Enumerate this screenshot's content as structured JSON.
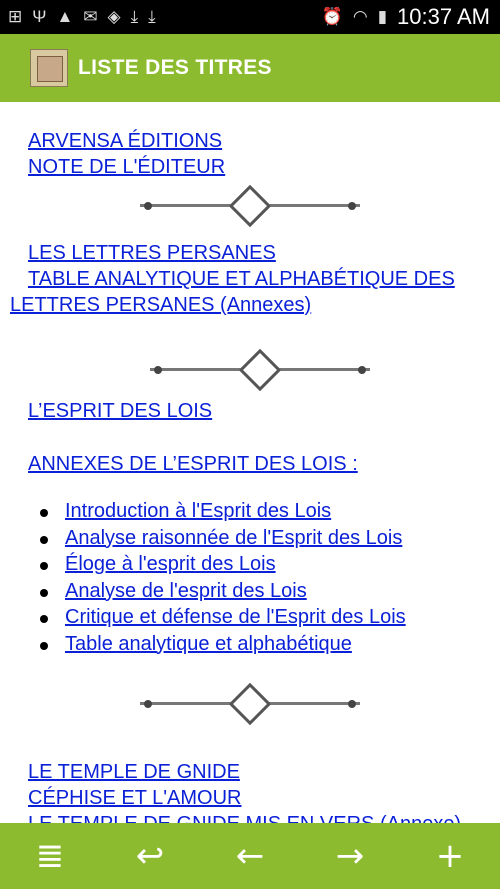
{
  "status_bar": {
    "time": "10:37 AM",
    "left_icons": [
      "plus-square-icon",
      "usb-icon",
      "warning-icon",
      "mail-blocked-icon",
      "shield-icon",
      "download-icon",
      "download-icon"
    ],
    "right_icons": [
      "alarm-icon",
      "wifi-icon",
      "battery-charging-icon"
    ]
  },
  "app_bar": {
    "title": "LISTE DES TITRES",
    "icon": "book-cover-icon",
    "color": "#8dbb2f"
  },
  "content": {
    "links_top": [
      "ARVENSA ÉDITIONS",
      "NOTE DE L'ÉDITEUR"
    ],
    "lettres": {
      "link1": "LES LETTRES PERSANES",
      "link2_line1": "TABLE ANALYTIQUE ET ALPHABÉTIQUE DES",
      "link2_line2": "LETTRES PERSANES (Annexes)"
    },
    "esprit": {
      "link": "L’ESPRIT DES LOIS",
      "annexes": "ANNEXES DE L’ESPRIT DES LOIS :",
      "bullets": [
        "Introduction à l'Esprit des Lois",
        "Analyse raisonnée de l'Esprit des Lois",
        "Éloge à l'esprit des Lois",
        "Analyse de l'esprit des Lois",
        "Critique et défense de l'Esprit des Lois",
        "Table analytique et alphabétique"
      ]
    },
    "temple": {
      "link1": "LE TEMPLE DE GNIDE",
      "link2": "CÉPHISE ET L'AMOUR",
      "link3": "LE TEMPLE DE GNIDE MIS EN VERS (Annexe)"
    }
  },
  "nav_bar": {
    "buttons": [
      {
        "name": "toc-button",
        "glyph": "≣"
      },
      {
        "name": "return-button",
        "glyph": "↩"
      },
      {
        "name": "back-button",
        "glyph": "←"
      },
      {
        "name": "forward-button",
        "glyph": "→"
      },
      {
        "name": "add-button",
        "glyph": "+"
      }
    ]
  }
}
